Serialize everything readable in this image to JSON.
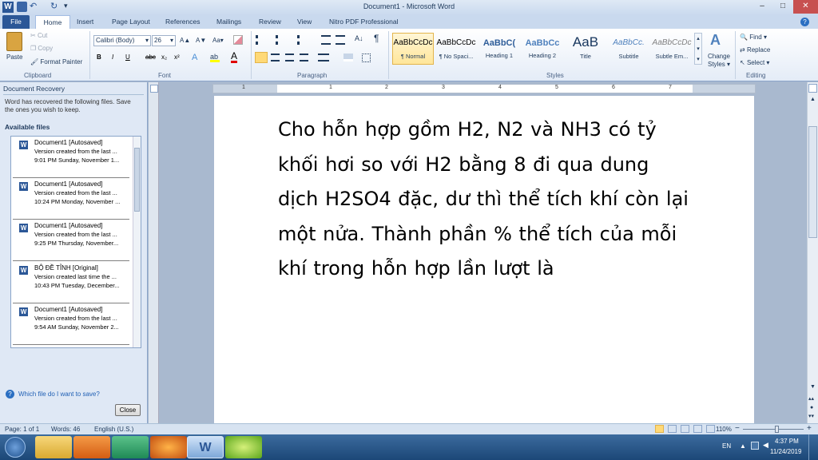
{
  "titlebar": {
    "title": "Document1 - Microsoft Word",
    "minimize": "–",
    "maximize": "□",
    "close": "✕",
    "qa_undo": "↶",
    "qa_redo": "↻",
    "qa_customize": "▾"
  },
  "tabs": [
    "File",
    "Home",
    "Insert",
    "Page Layout",
    "References",
    "Mailings",
    "Review",
    "View",
    "Nitro PDF Professional"
  ],
  "ribbon": {
    "clipboard": {
      "label": "Clipboard",
      "paste": "Paste",
      "cut": "Cut",
      "copy": "Copy",
      "format_painter": "Format Painter"
    },
    "font": {
      "label": "Font",
      "name": "Calibri (Body)",
      "size": "26",
      "grow": "A▲",
      "shrink": "A▼",
      "case": "Aa▾",
      "bold": "B",
      "italic": "I",
      "underline": "U",
      "strike": "abc",
      "sub": "x₂",
      "sup": "x²"
    },
    "paragraph": {
      "label": "Paragraph",
      "pilcrow": "¶"
    },
    "styles": {
      "label": "Styles",
      "tiles": [
        {
          "sample": "AaBbCcDc",
          "name": "¶ Normal"
        },
        {
          "sample": "AaBbCcDc",
          "name": "¶ No Spaci..."
        },
        {
          "sample": "AaBbC(",
          "name": "Heading 1"
        },
        {
          "sample": "AaBbCc",
          "name": "Heading 2"
        },
        {
          "sample": "AaB",
          "name": "Title"
        },
        {
          "sample": "AaBbCc.",
          "name": "Subtitle"
        },
        {
          "sample": "AaBbCcDc",
          "name": "Subtle Em..."
        }
      ],
      "change": "Change Styles ▾"
    },
    "editing": {
      "label": "Editing",
      "find": "Find ▾",
      "replace": "Replace",
      "select": "Select ▾"
    }
  },
  "recovery": {
    "title": "Document Recovery",
    "message": "Word has recovered the following files.  Save the ones you wish to keep.",
    "available": "Available files",
    "files": [
      {
        "name": "Document1  [Autosaved]",
        "version": "Version created from the last ...",
        "time": "9:01 PM Sunday, November 1..."
      },
      {
        "name": "Document1  [Autosaved]",
        "version": "Version created from the last ...",
        "time": "10:24 PM Monday, November ..."
      },
      {
        "name": "Document1  [Autosaved]",
        "version": "Version created from the last ...",
        "time": "9:25 PM Thursday, November..."
      },
      {
        "name": "BỘ ĐỀ TỈNH  [Original]",
        "version": "Version created last time the ...",
        "time": "10:43 PM Tuesday, December..."
      },
      {
        "name": "Document1  [Autosaved]",
        "version": "Version created from the last ...",
        "time": "9:54 AM Sunday, November 2..."
      }
    ],
    "help_link": "Which file do I want to save?",
    "close": "Close"
  },
  "ruler": {
    "numbers": [
      "1",
      "1",
      "2",
      "3",
      "4",
      "5",
      "6",
      "7"
    ]
  },
  "document": {
    "text": "Cho hỗn hợp gồm H2, N2 và NH3 có tỷ khối hơi so với H2 bằng 8 đi qua dung dịch H2SO4 đặc, dư thì thể tích khí còn lại một nửa. Thành phần % thể tích của mỗi khí trong hỗn hợp lần lượt là"
  },
  "statusbar": {
    "page": "Page: 1 of 1",
    "words": "Words: 46",
    "language": "English (U.S.)",
    "zoom": "110%"
  },
  "taskbar": {
    "lang": "EN",
    "time": "4:37 PM",
    "date": "11/24/2019"
  }
}
